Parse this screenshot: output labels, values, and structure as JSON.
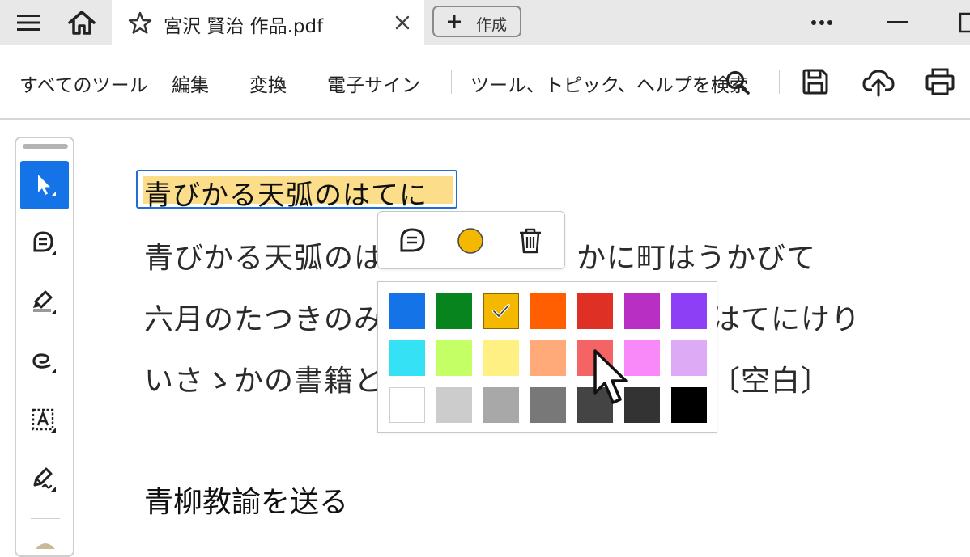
{
  "tab": {
    "title": "宮沢 賢治 作品.pdf",
    "create_label": "作成"
  },
  "toolbar": {
    "items": [
      "すべてのツール",
      "編集",
      "変換",
      "電子サイン"
    ],
    "search_label": "ツール、トピック、ヘルプを検索"
  },
  "document": {
    "heading": "青びかる天弧のはてに",
    "lines": [
      "青びかる天弧のは",
      "かに町はうかびて",
      "六月のたつきのみ",
      "はてにけり",
      "いさゝかの書籍と",
      "〔空白〕"
    ],
    "subheading": "青柳教諭を送る"
  },
  "annotation_popup": {
    "current_color": "#f5b800",
    "icons": [
      "comment-icon",
      "color-circle-icon",
      "trash-icon"
    ]
  },
  "palette": {
    "selected_index": 2,
    "hovered_index": 11,
    "colors": [
      "#1473e6",
      "#07841e",
      "#f5b800",
      "#ff5f00",
      "#de3025",
      "#b82fc4",
      "#8c3ff5",
      "#34e1f5",
      "#c5ff66",
      "#fef083",
      "#ffaa78",
      "#f56464",
      "#f989f9",
      "#ddaaf5",
      "#ffffff",
      "#cccccc",
      "#a8a8a8",
      "#787878",
      "#444444",
      "#333333",
      "#000000"
    ]
  }
}
